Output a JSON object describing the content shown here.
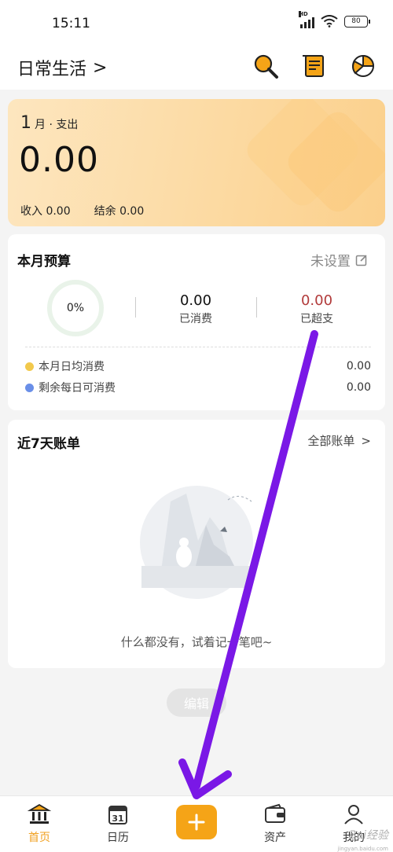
{
  "status_bar": {
    "time": "15:11",
    "network": "HD",
    "battery": "80"
  },
  "header": {
    "book_name": "日常生活",
    "chevron": ">",
    "icons": [
      "search-icon",
      "bill-scroll-icon",
      "pie-chart-icon"
    ]
  },
  "summary": {
    "month": "1",
    "month_suffix": "月 · 支出",
    "expense": "0.00",
    "income_label": "收入 0.00",
    "balance_label": "结余 0.00"
  },
  "budget": {
    "title": "本月预算",
    "setting": "未设置",
    "percent": "0%",
    "spent_value": "0.00",
    "spent_label": "已消费",
    "over_value": "0.00",
    "over_label": "已超支",
    "rows": [
      {
        "label": "本月日均消费",
        "value": "0.00",
        "dot_color": "#f2c94c"
      },
      {
        "label": "剩余每日可消费",
        "value": "0.00",
        "dot_color": "#6a8fe8"
      }
    ]
  },
  "bills": {
    "title": "近7天账单",
    "all_link": "全部账单",
    "chevron": ">",
    "empty_text": "什么都没有，试着记一笔吧~"
  },
  "edit_button": "编辑",
  "nav": {
    "home": "首页",
    "calendar": "日历",
    "calendar_day": "31",
    "add": "+",
    "assets": "资产",
    "me": "我的"
  },
  "watermark": {
    "text": "Bai经验",
    "sub": "jingyan.baidu.com"
  },
  "colors": {
    "accent": "#f5a417",
    "arrow": "#7a18e6",
    "over_red": "#b23b3b"
  }
}
